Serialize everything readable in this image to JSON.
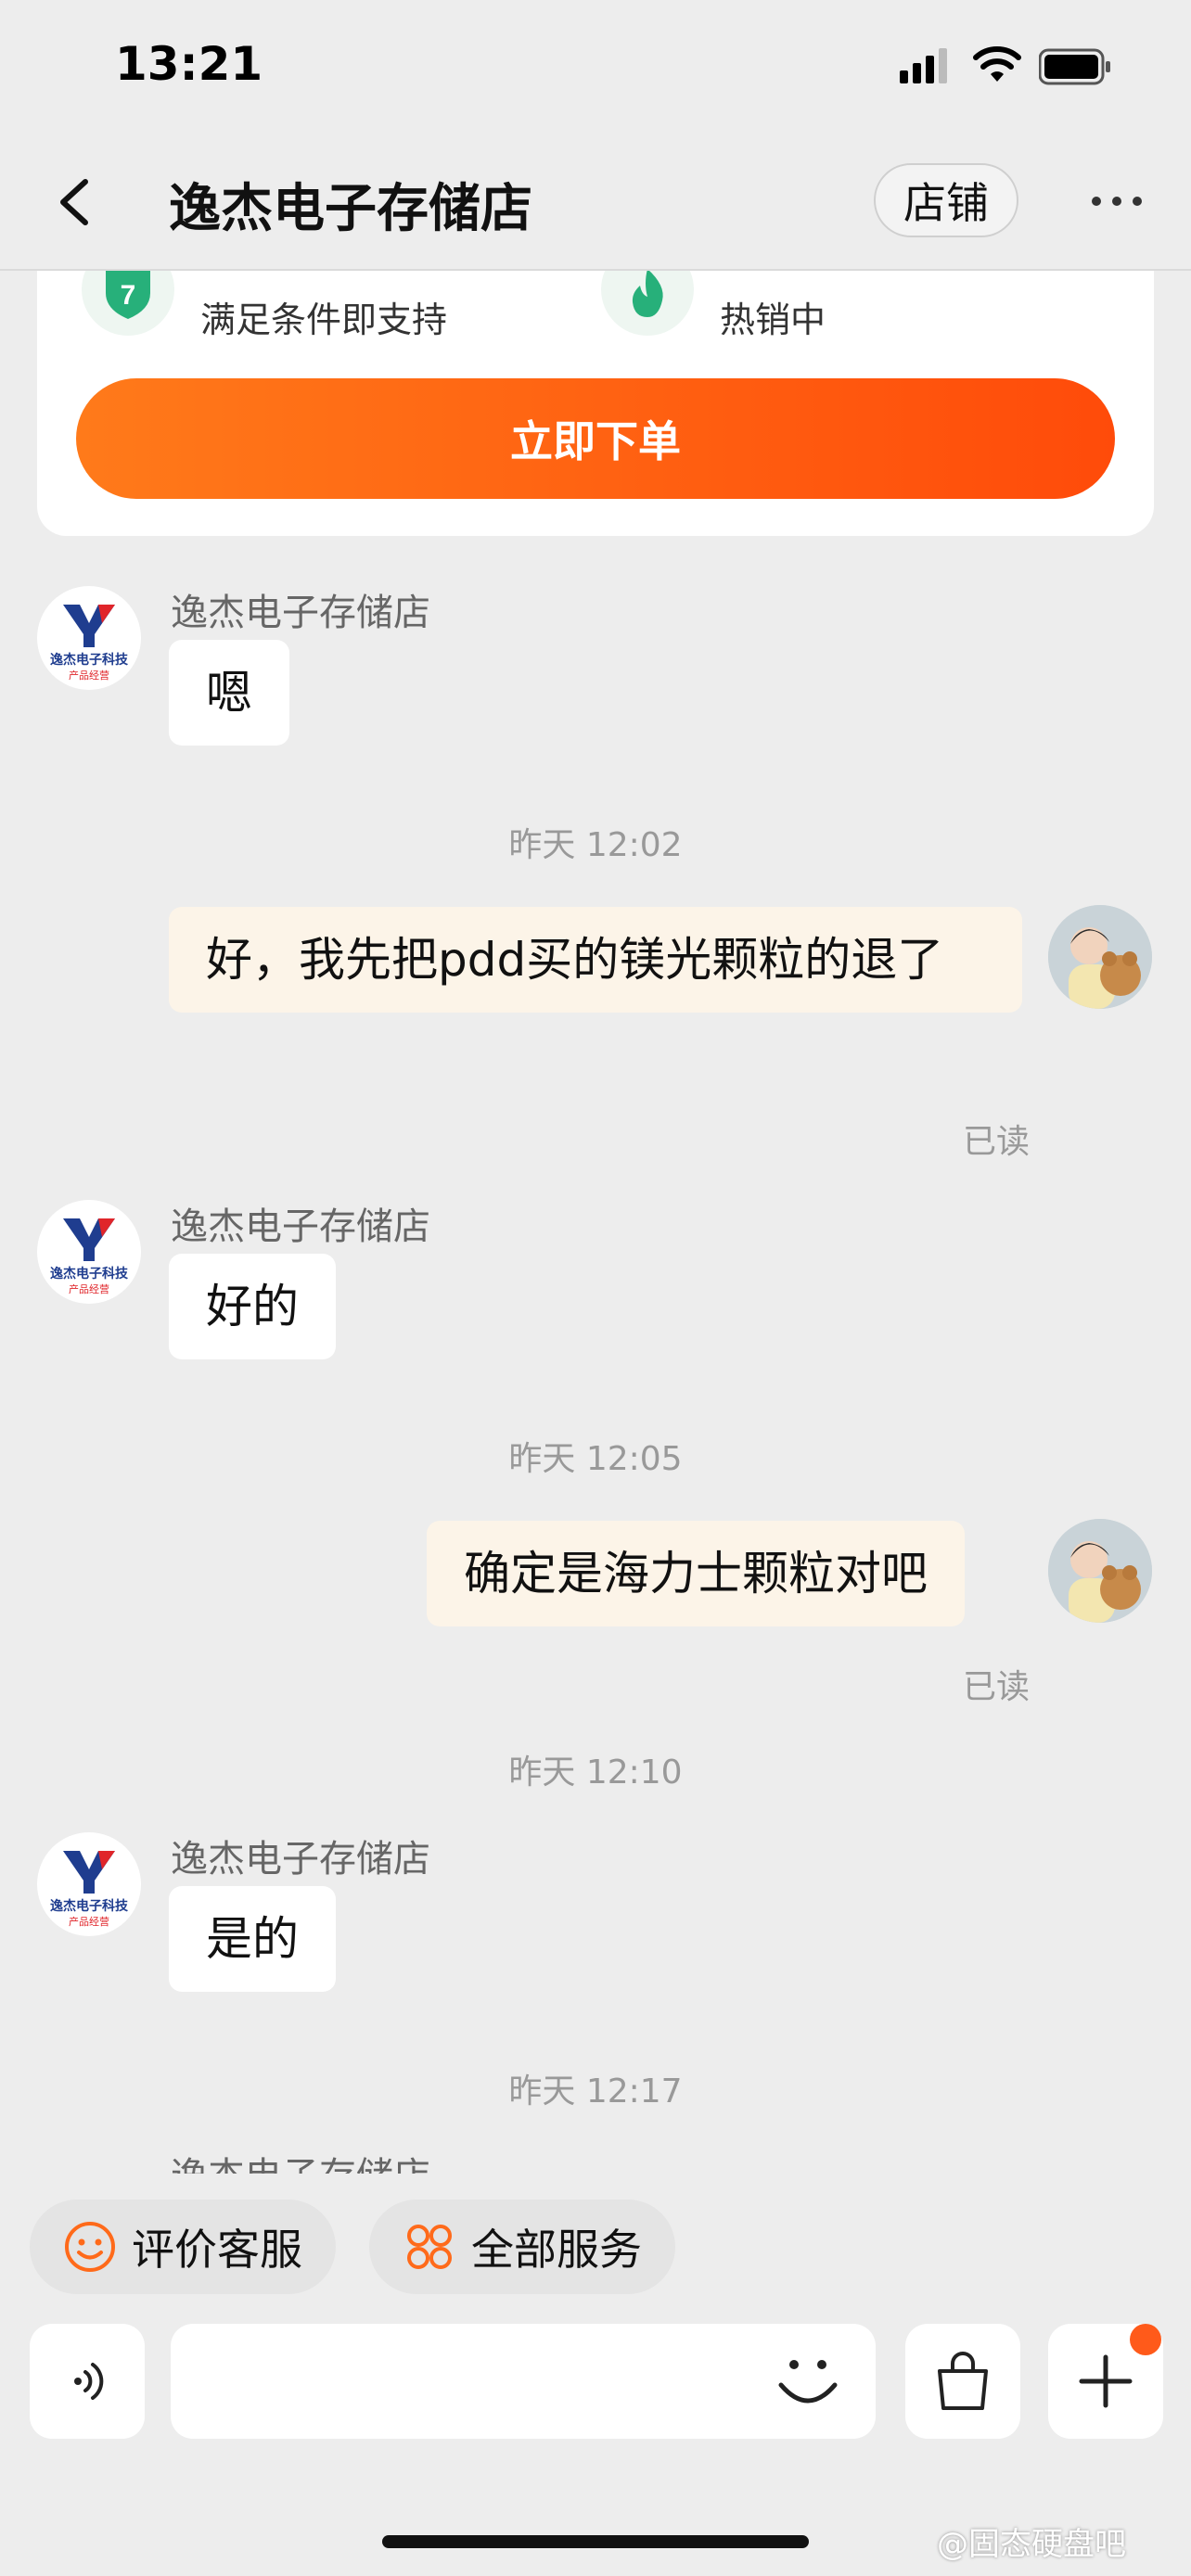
{
  "status": {
    "time": "13:21"
  },
  "nav": {
    "title": "逸杰电子存储店",
    "shop_button": "店铺"
  },
  "product_card": {
    "feature_left": "满足条件即支持",
    "feature_left_badge": "7",
    "feature_right": "热销中",
    "order_button": "立即下单"
  },
  "shop_avatar": {
    "text_line1": "逸杰电子科技",
    "text_line2": "产品经营"
  },
  "messages": [
    {
      "type": "in",
      "sender": "逸杰电子存储店",
      "text": "嗯"
    },
    {
      "type": "time",
      "text": "昨天 12:02"
    },
    {
      "type": "out",
      "text": "好，我先把pdd买的镁光颗粒的退了",
      "status": "已读"
    },
    {
      "type": "in",
      "sender": "逸杰电子存储店",
      "text": "好的"
    },
    {
      "type": "time",
      "text": "昨天 12:05"
    },
    {
      "type": "out",
      "text": "确定是海力士颗粒对吧",
      "status": "已读"
    },
    {
      "type": "time",
      "text": "昨天 12:10"
    },
    {
      "type": "in",
      "sender": "逸杰电子存储店",
      "text": "是的"
    },
    {
      "type": "time",
      "text": "昨天 12:17"
    },
    {
      "type": "in",
      "sender": "逸杰电子存储店"
    }
  ],
  "quick_actions": {
    "rate": "评价客服",
    "all_services": "全部服务"
  },
  "watermark": "@固态硬盘吧",
  "colors": {
    "accent": "#ff5a1a",
    "out_bubble": "#fcf4e8",
    "background": "#ededed"
  }
}
